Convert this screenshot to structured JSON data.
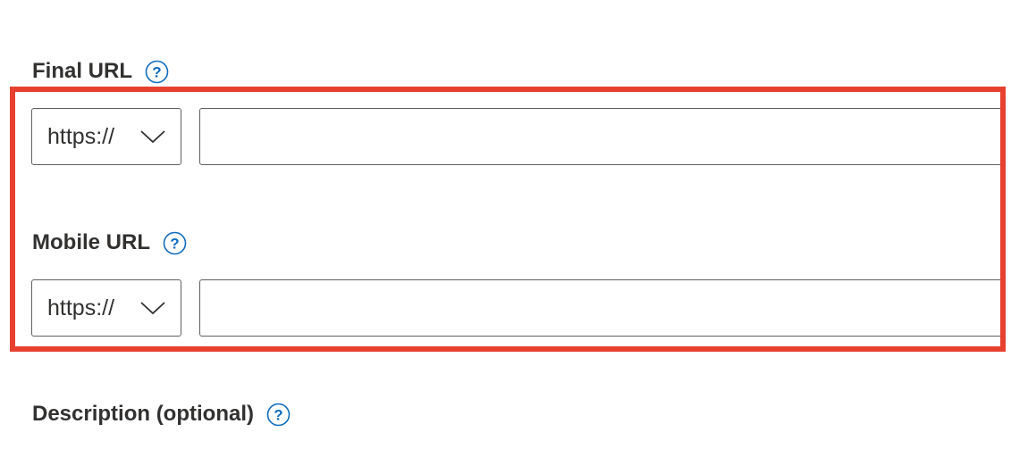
{
  "final_url": {
    "label": "Final URL",
    "protocol": "https://",
    "value": ""
  },
  "mobile_url": {
    "label": "Mobile URL",
    "protocol": "https://",
    "value": ""
  },
  "description": {
    "label": "Description (optional)"
  },
  "icons": {
    "help": "question-circle-icon",
    "dropdown": "chevron-down-icon"
  },
  "colors": {
    "help_icon": "#0f6cbd",
    "highlight": "#e8402f",
    "border": "#605e5c",
    "text": "#323130"
  }
}
